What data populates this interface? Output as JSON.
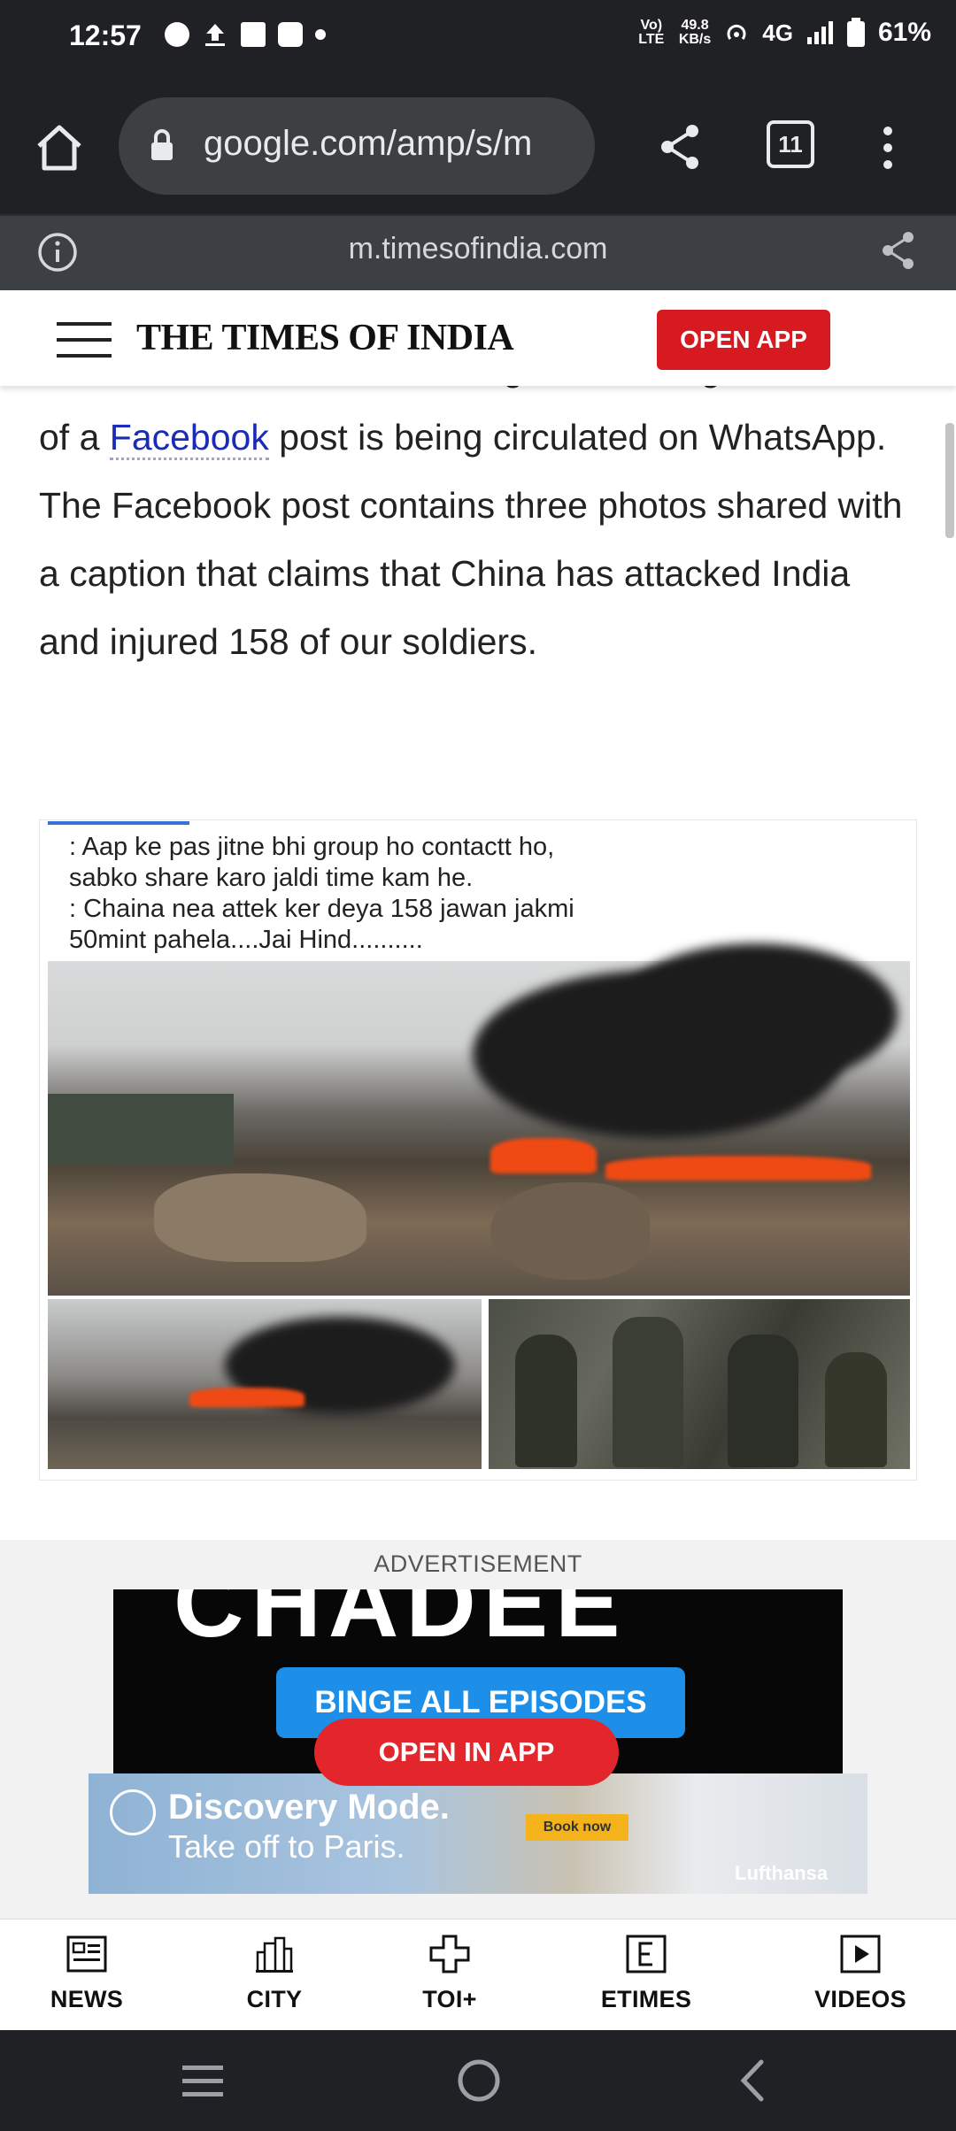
{
  "status_bar": {
    "time": "12:57",
    "volte": "Vo) LTE",
    "net_speed_value": "49.8",
    "net_speed_unit": "KB/s",
    "network": "4G",
    "battery": "61%"
  },
  "browser": {
    "url": "google.com/amp/s/m",
    "tab_count": "11",
    "source_domain": "m.timesofindia.com"
  },
  "site": {
    "logo_text": "THE TIMES OF INDIA",
    "open_app_label": "OPEN APP"
  },
  "article": {
    "partial_top": "India and China in Ladakh region, screengrab",
    "text_before_link": "of a ",
    "link_text": "Facebook",
    "text_after_link": " post is being circulated on WhatsApp. The Facebook post contains three photos shared with a caption that claims that China has attacked India and injured 158 of our soldiers."
  },
  "post_image": {
    "caption_line1": ": Aap ke pas jitne bhi group ho contactt ho,",
    "caption_line2": "sabko share  karo jaldi time kam he.",
    "caption_line3": ": Chaina nea attek ker deya 158 jawan jakmi",
    "caption_line4": "50mint pahela....Jai Hind.........."
  },
  "advertisement": {
    "label": "ADVERTISEMENT",
    "show_title_partial": "CHADEE",
    "binge_label": "BINGE ALL EPISODES",
    "open_in_app_label": "OPEN IN APP",
    "banner_title": "Discovery Mode.",
    "banner_subtitle": "Take off to Paris.",
    "banner_cta": "Book now",
    "banner_brand": "Lufthansa"
  },
  "bottom_nav": {
    "items": [
      {
        "label": "NEWS",
        "icon": "newspaper-icon"
      },
      {
        "label": "CITY",
        "icon": "city-buildings-icon"
      },
      {
        "label": "TOI+",
        "icon": "toi-plus-icon"
      },
      {
        "label": "ETIMES",
        "icon": "etimes-icon"
      },
      {
        "label": "VIDEOS",
        "icon": "play-icon"
      }
    ]
  },
  "colors": {
    "chrome_dark": "#202124",
    "open_app_red": "#d71920",
    "link_blue": "#1a2bb7",
    "binge_blue": "#1e8fe8"
  }
}
